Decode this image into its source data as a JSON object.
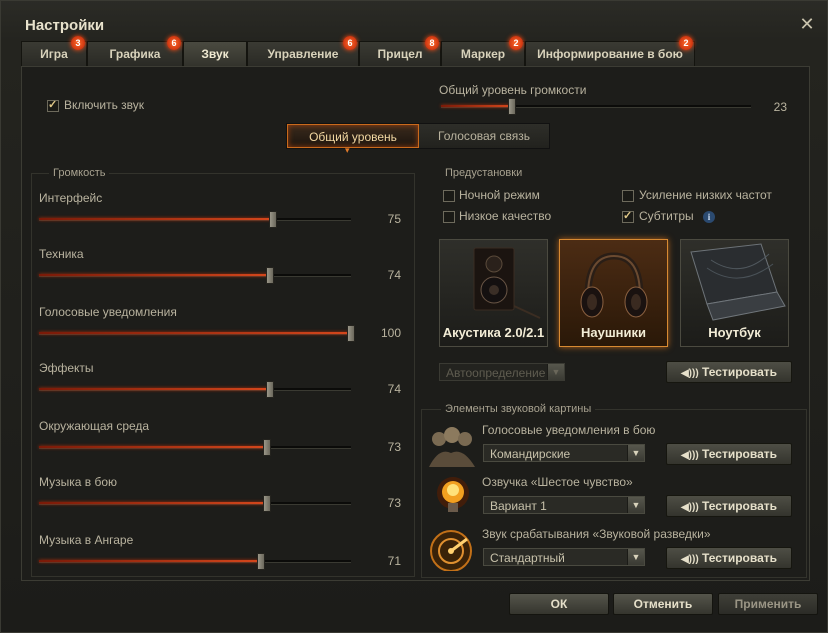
{
  "window": {
    "title": "Настройки"
  },
  "tabs": [
    {
      "label": "Игра",
      "badge": "3"
    },
    {
      "label": "Графика",
      "badge": "6"
    },
    {
      "label": "Звук",
      "badge": ""
    },
    {
      "label": "Управление",
      "badge": "6"
    },
    {
      "label": "Прицел",
      "badge": "8"
    },
    {
      "label": "Маркер",
      "badge": "2"
    },
    {
      "label": "Информирование в бою",
      "badge": "2"
    }
  ],
  "sound": {
    "enable_label": "Включить звук",
    "enable_checked": true,
    "master": {
      "label": "Общий уровень громкости",
      "value": 23
    }
  },
  "subtabs": [
    "Общий уровень",
    "Голосовая связь"
  ],
  "volume": {
    "title": "Громкость",
    "sliders": [
      {
        "label": "Интерфейс",
        "value": 75
      },
      {
        "label": "Техника",
        "value": 74
      },
      {
        "label": "Голосовые уведомления",
        "value": 100
      },
      {
        "label": "Эффекты",
        "value": 74
      },
      {
        "label": "Окружающая среда",
        "value": 73
      },
      {
        "label": "Музыка в бою",
        "value": 73
      },
      {
        "label": "Музыка в Ангаре",
        "value": 71
      }
    ]
  },
  "presets": {
    "title": "Предустановки",
    "night": {
      "label": "Ночной режим",
      "checked": false
    },
    "bass": {
      "label": "Усиление низких частот",
      "checked": false
    },
    "low": {
      "label": "Низкое качество",
      "checked": false
    },
    "subs": {
      "label": "Субтитры",
      "checked": true
    },
    "info": "i",
    "cards": [
      {
        "label": "Акустика 2.0/2.1",
        "icon": "speaker-icon"
      },
      {
        "label": "Наушники",
        "icon": "headphones-icon"
      },
      {
        "label": "Ноутбук",
        "icon": "laptop-icon"
      }
    ],
    "autodetect": "Автоопределение",
    "test": "Тестировать"
  },
  "elements": {
    "title": "Элементы звуковой картины",
    "rows": [
      {
        "label": "Голосовые уведомления в бою",
        "value": "Командирские",
        "icon": "crew-icon"
      },
      {
        "label": "Озвучка «Шестое чувство»",
        "value": "Вариант 1",
        "icon": "lamp-icon"
      },
      {
        "label": "Звук срабатывания «Звуковой разведки»",
        "value": "Стандартный",
        "icon": "radar-icon"
      }
    ],
    "test": "Тестировать"
  },
  "footer": {
    "ok": "ОК",
    "cancel": "Отменить",
    "apply": "Применить"
  },
  "colors": {
    "accent": "#d5471c",
    "badge": "#e03a0c",
    "active_card": "#d88a32"
  }
}
